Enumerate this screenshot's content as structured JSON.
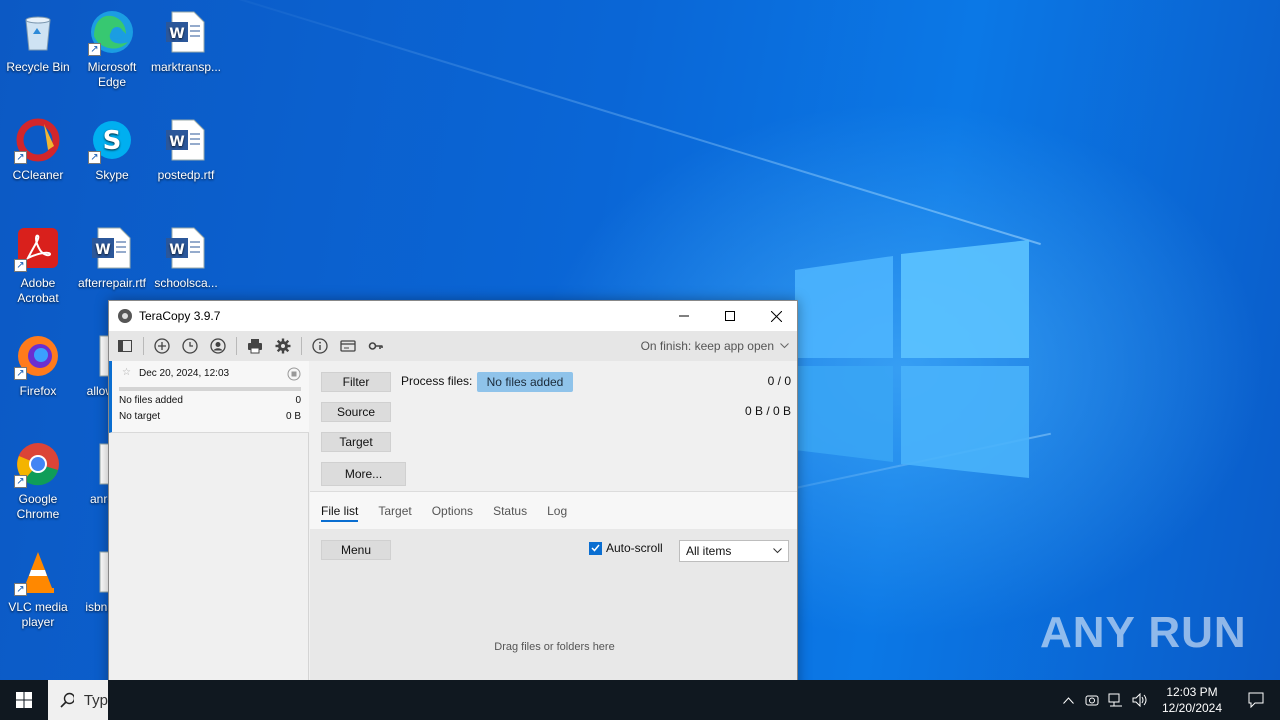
{
  "desktop": {
    "icons": [
      {
        "label": "Recycle Bin",
        "icon": "recycle-bin-icon"
      },
      {
        "label": "Microsoft Edge",
        "icon": "edge-icon"
      },
      {
        "label": "marktransp...",
        "icon": "word-doc-icon"
      },
      {
        "label": "CCleaner",
        "icon": "ccleaner-icon"
      },
      {
        "label": "Skype",
        "icon": "skype-icon"
      },
      {
        "label": "postedp.rtf",
        "icon": "word-doc-icon"
      },
      {
        "label": "Adobe Acrobat",
        "icon": "acrobat-icon"
      },
      {
        "label": "afterrepair.rtf",
        "icon": "word-doc-icon"
      },
      {
        "label": "schoolsca...",
        "icon": "word-doc-icon"
      },
      {
        "label": "Firefox",
        "icon": "firefox-icon"
      },
      {
        "label": "allow",
        "icon": "document-icon"
      },
      {
        "label": "Google Chrome",
        "icon": "chrome-icon"
      },
      {
        "label": "anro",
        "icon": "document-icon"
      },
      {
        "label": "VLC media player",
        "icon": "vlc-icon"
      },
      {
        "label": "isbna",
        "icon": "document-icon"
      }
    ],
    "watermark": "ANY RUN"
  },
  "taskbar": {
    "search_text": "Typ",
    "time": "12:03 PM",
    "date": "12/20/2024"
  },
  "teracopy": {
    "title": "TeraCopy 3.9.7",
    "on_finish": "On finish: keep app open",
    "job": {
      "date": "Dec 20, 2024, 12:03",
      "files_label": "No files added",
      "files_count": "0",
      "target_label": "No target",
      "target_size": "0 B"
    },
    "buttons": {
      "filter": "Filter",
      "source": "Source",
      "target": "Target",
      "more": "More...",
      "menu": "Menu"
    },
    "process_files_label": "Process files:",
    "no_files_badge": "No files added",
    "count": "0 / 0",
    "size": "0 B / 0 B",
    "tabs": [
      "File list",
      "Target",
      "Options",
      "Status",
      "Log"
    ],
    "active_tab": "File list",
    "auto_scroll_label": "Auto-scroll",
    "auto_scroll_checked": true,
    "filter_select": "All items",
    "drop_hint": "Drag files or folders here"
  },
  "colors": {
    "accent": "#0a6ed1",
    "badge": "#8fc3ea",
    "taskbar": "#101820"
  }
}
